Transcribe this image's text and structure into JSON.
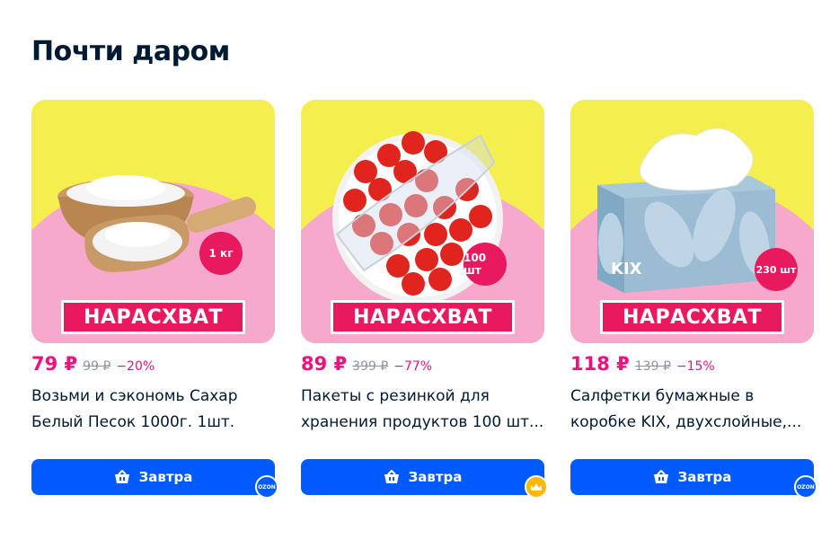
{
  "section": {
    "title": "Почти даром"
  },
  "products": [
    {
      "promo": "НАРАСХВАТ",
      "qty_badge": "1 кг",
      "price": "79 ₽",
      "old_price": "99 ₽",
      "discount": "−20%",
      "title_line1": "Возьми и сэкономь Сахар",
      "title_line2": "Белый Песок 1000г. 1шт.",
      "button": "Завтра",
      "corner_badge": "OZON"
    },
    {
      "promo": "НАРАСХВАТ",
      "qty_badge": "100 шт",
      "price": "89 ₽",
      "old_price": "399 ₽",
      "discount": "−77%",
      "title_line1": "Пакеты с резинкой для",
      "title_line2": "хранения продуктов 100 шт...",
      "button": "Завтра",
      "corner_badge": "premium-crown"
    },
    {
      "promo": "НАРАСХВАТ",
      "qty_badge": "230 шт",
      "brand_print": "KIX",
      "price": "118 ₽",
      "old_price": "139 ₽",
      "discount": "−15%",
      "title_line1": "Салфетки бумажные в",
      "title_line2": "коробке KIX, двухслойные,...",
      "button": "Завтра",
      "corner_badge": "OZON"
    }
  ],
  "colors": {
    "accent_blue": "#005bff",
    "price_pink": "#f1117e",
    "promo_yellow": "#f4ef4e",
    "promo_pink": "#f6a9cc"
  }
}
